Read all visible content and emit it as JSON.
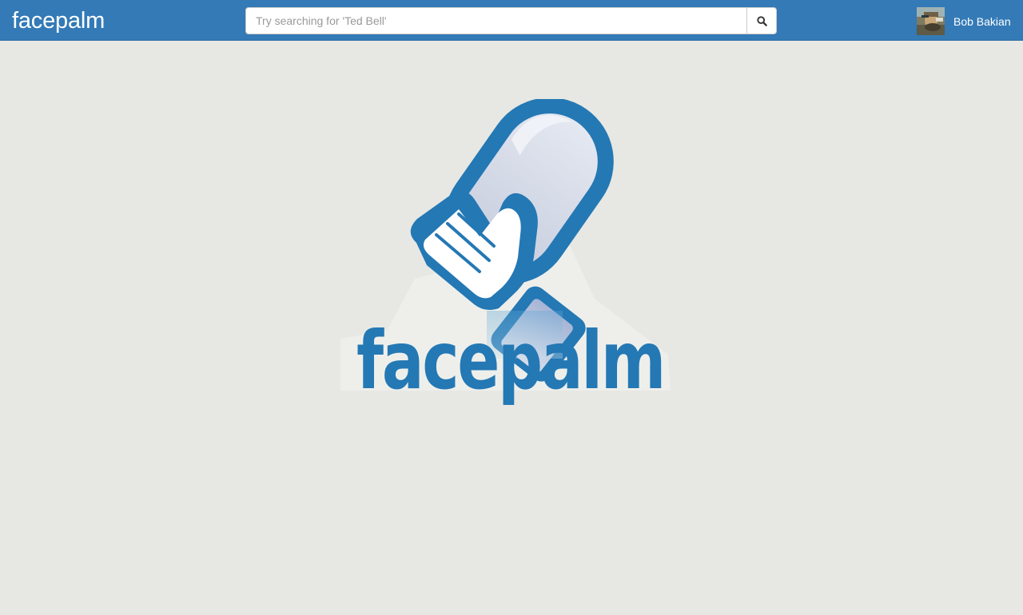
{
  "navbar": {
    "brand": "facepalm",
    "search": {
      "placeholder": "Try searching for 'Ted Bell'",
      "value": "",
      "button_icon": "search-icon"
    },
    "user": {
      "name": "Bob Bakian",
      "avatar_icon": "avatar-photo"
    }
  },
  "hero": {
    "logo_icon": "facepalm-hand-logo",
    "logo_text": "facepalm"
  },
  "colors": {
    "navbar_bg": "#337ab7",
    "page_bg": "#e7e8e3",
    "logo_blue": "#2478b4",
    "white": "#ffffff"
  }
}
